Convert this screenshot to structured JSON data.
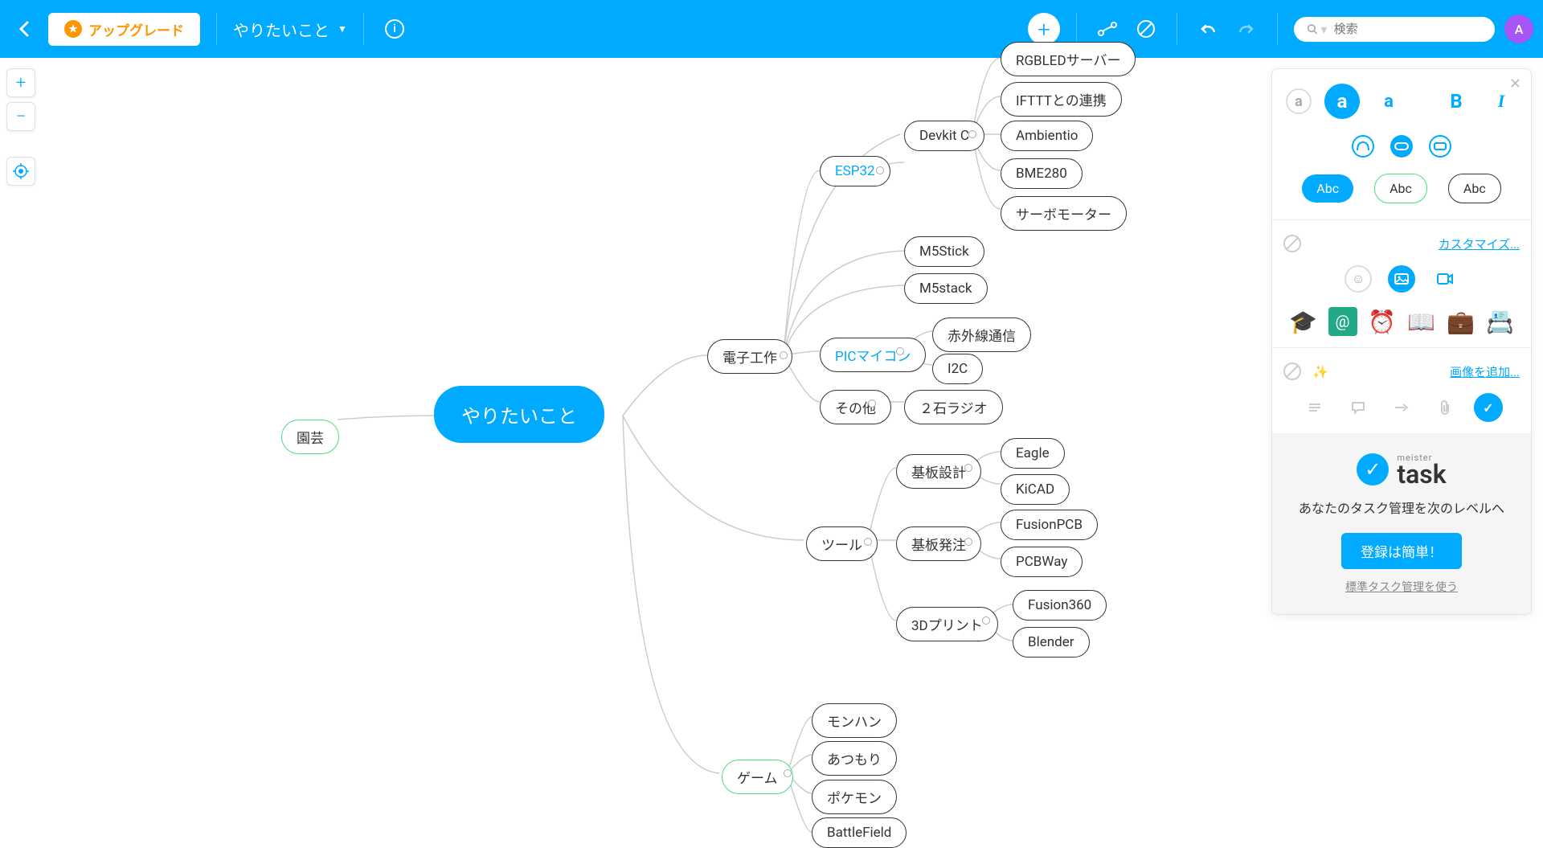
{
  "header": {
    "upgrade": "アップグレード",
    "title": "やりたいこと",
    "search_placeholder": "検索",
    "avatar": "A"
  },
  "nodes": {
    "root": "やりたいこと",
    "gardening": "園芸",
    "electronics": "電子工作",
    "esp32": "ESP32",
    "devkitc": "Devkit C",
    "rgbled": "RGBLEDサーバー",
    "ifttt": "IFTTTとの連携",
    "ambientio": "Ambientio",
    "bme280": "BME280",
    "servo": "サーボモーター",
    "m5stick": "M5Stick",
    "m5stack": "M5stack",
    "pic": "PICマイコン",
    "ir": "赤外線通信",
    "i2c": "I2C",
    "other": "その他",
    "radio2": "２石ラジオ",
    "tools": "ツール",
    "pcbdesign": "基板設計",
    "eagle": "Eagle",
    "kicad": "KiCAD",
    "pcborder": "基板発注",
    "fusionpcb": "FusionPCB",
    "pcbway": "PCBWay",
    "print3d": "3Dプリント",
    "fusion360": "Fusion360",
    "blender": "Blender",
    "games": "ゲーム",
    "monhan": "モンハン",
    "atsumori": "あつもり",
    "pokemon": "ポケモン",
    "bf": "BattleField"
  },
  "sidebar": {
    "font_a": "a",
    "font_B": "B",
    "font_I": "I",
    "abc": "Abc",
    "customize": "カスタマイズ...",
    "add_image": "画像を追加...",
    "task_brand_small": "meister",
    "task_brand": "task",
    "task_desc": "あなたのタスク管理を次のレベルへ",
    "task_button": "登録は簡単！",
    "task_alt": "標準タスク管理を使う"
  }
}
